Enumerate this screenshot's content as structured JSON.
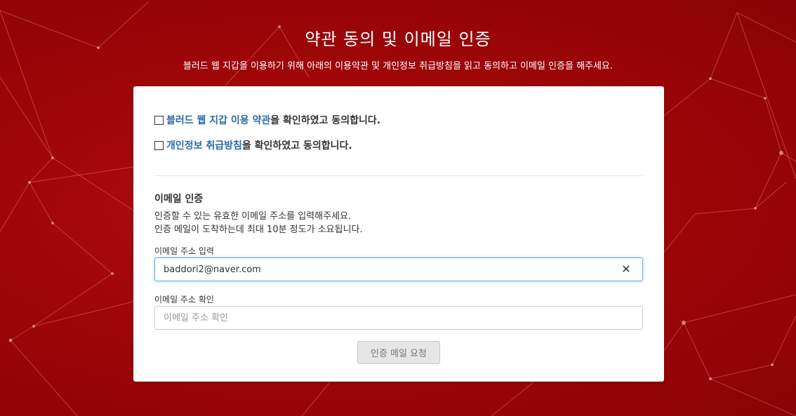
{
  "header": {
    "title": "약관 동의 및 이메일 인증",
    "subtitle": "블러드 웹 지갑을 이용하기 위해 아래의 이용약관 및 개인정보 취급방침을 읽고 동의하고 이메일 인증을 해주세요."
  },
  "agreements": [
    {
      "link_text": "블러드 웹 지갑 이용 약관",
      "suffix": "을 확인하였고 동의합니다.",
      "checked": false
    },
    {
      "link_text": "개인정보 취급방침",
      "suffix": "을 확인하였고 동의합니다.",
      "checked": false
    }
  ],
  "email_section": {
    "title": "이메일 인증",
    "desc_line1": "인증할 수 있는 유효한 이메일 주소를 입력해주세요.",
    "desc_line2": "인증 메일이 도착하는데 최대 10분 정도가 소요됩니다.",
    "email_label": "이메일 주소 입력",
    "email_value": "baddori2@naver.com",
    "clear_icon": "close-icon",
    "confirm_label": "이메일 주소 확인",
    "confirm_placeholder": "이메일 주소 확인",
    "confirm_value": "",
    "submit_label": "인증 메일 요청"
  },
  "colors": {
    "background": "#9c0508",
    "link": "#2a6aa8",
    "focus_border": "#66afe9"
  }
}
